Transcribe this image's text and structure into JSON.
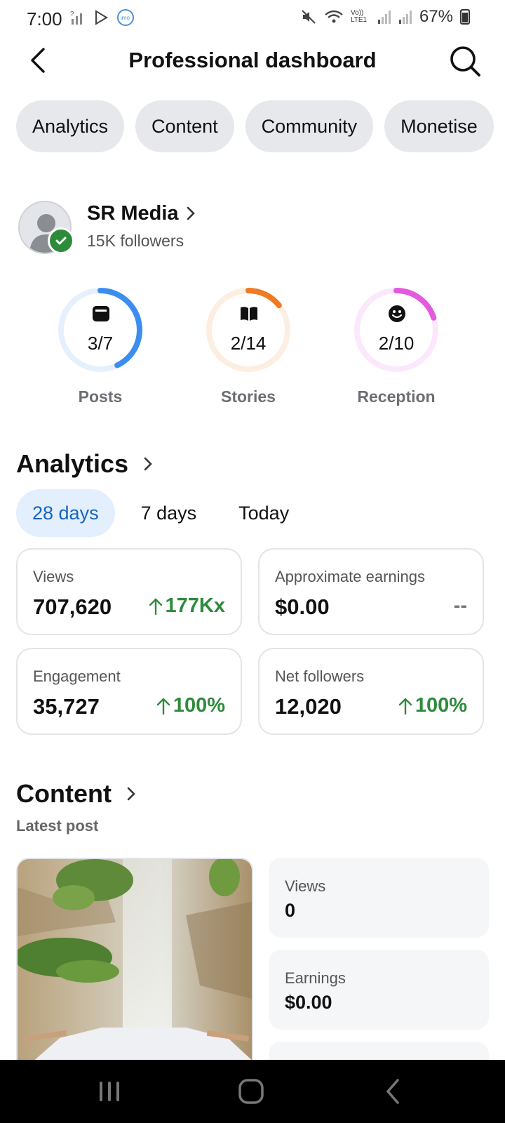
{
  "status_bar": {
    "time": "7:00",
    "network_label": "Vo)) LTE1",
    "battery_percent": "67%"
  },
  "header": {
    "title": "Professional dashboard"
  },
  "chips": [
    "Analytics",
    "Content",
    "Community",
    "Monetise"
  ],
  "profile": {
    "name": "SR Media",
    "followers": "15K followers"
  },
  "rings": [
    {
      "label": "Posts",
      "value": "3/7",
      "progress": 0.4286,
      "color": "#3b8ef0",
      "track": "#e6f0fd"
    },
    {
      "label": "Stories",
      "value": "2/14",
      "progress": 0.1429,
      "color": "#ef7a22",
      "track": "#fdeee2"
    },
    {
      "label": "Reception",
      "value": "2/10",
      "progress": 0.2,
      "color": "#e35adf",
      "track": "#fce8fc"
    }
  ],
  "analytics": {
    "title": "Analytics",
    "ranges": [
      "28 days",
      "7 days",
      "Today"
    ],
    "active_range": "28 days",
    "cards": [
      {
        "label": "Views",
        "value": "707,620",
        "delta": "177Kx",
        "trend": "up"
      },
      {
        "label": "Approximate earnings",
        "value": "$0.00",
        "delta": "--",
        "trend": "none"
      },
      {
        "label": "Engagement",
        "value": "35,727",
        "delta": "100%",
        "trend": "up"
      },
      {
        "label": "Net followers",
        "value": "12,020",
        "delta": "100%",
        "trend": "up"
      }
    ]
  },
  "content": {
    "title": "Content",
    "subtitle": "Latest post",
    "metrics": [
      {
        "label": "Views",
        "value": "0"
      },
      {
        "label": "Earnings",
        "value": "$0.00"
      }
    ]
  }
}
